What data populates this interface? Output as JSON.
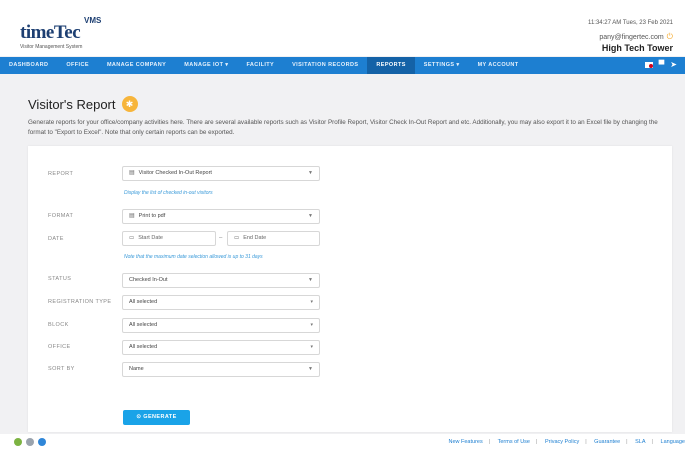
{
  "header": {
    "brand_time": "time",
    "brand_tec": "Tec",
    "brand_vms": "VMS",
    "subtitle": "Visitor Management System",
    "datetime": "11:34:27 AM Tues, 23 Feb 2021",
    "email": "pany@fingertec.com",
    "power_icon": "power-icon",
    "location": "High Tech Tower"
  },
  "nav": {
    "items": [
      {
        "label": "DASHBOARD"
      },
      {
        "label": "OFFICE"
      },
      {
        "label": "MANAGE COMPANY"
      },
      {
        "label": "MANAGE IOT ▾"
      },
      {
        "label": "FACILITY"
      },
      {
        "label": "VISITATION RECORDS"
      },
      {
        "label": "REPORTS"
      },
      {
        "label": "SETTINGS ▾"
      },
      {
        "label": "MY ACCOUNT"
      }
    ],
    "active": "REPORTS",
    "icons": [
      "flag-icon",
      "cart-icon",
      "send-icon"
    ]
  },
  "page": {
    "title": "Visitor's Report",
    "description": "Generate reports for your office/company activities here. There are several available reports such as Visitor Profile Report, Visitor Check In-Out Report and etc. Additionally, you may also export it to an Excel file by changing the format to \"Export to Excel\". Note that only certain reports can be exported."
  },
  "form": {
    "report_label": "REPORT",
    "report_value": "Visitor Checked In-Out Report",
    "report_hint": "Display the list of checked in-out visitors",
    "format_label": "FORMAT",
    "format_value": "Print to pdf",
    "date_label": "DATE",
    "start_date_placeholder": "Start Date",
    "end_date_placeholder": "End Date",
    "date_hint": "Note that the maximum date selection allowed is up to 31 days",
    "status_label": "STATUS",
    "status_value": "Checked In-Out",
    "registration_label": "REGISTRATION TYPE",
    "registration_value": "All selected",
    "block_label": "BLOCK",
    "block_value": "All selected",
    "office_label": "OFFICE",
    "office_value": "All selected",
    "sortby_label": "SORT BY",
    "sortby_value": "Name",
    "generate_label": "GENERATE"
  },
  "footer": {
    "os_icons": [
      "android-icon",
      "apple-icon",
      "windows-icon"
    ],
    "links": [
      "New Features",
      "Terms of Use",
      "Privacy Policy",
      "Guarantee",
      "SLA",
      "Language"
    ]
  },
  "colors": {
    "nav": "#1d7fd1",
    "nav_active": "#1462a7",
    "generate": "#1aa3e8",
    "hint": "#3a9ad9",
    "bulb": "#f7b53b"
  }
}
